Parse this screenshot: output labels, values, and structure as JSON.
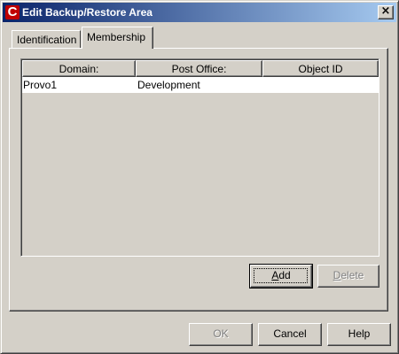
{
  "window": {
    "title": "Edit Backup/Restore Area",
    "icon_glyph": "C",
    "close_label": "×"
  },
  "tabs": [
    {
      "label": "Identification",
      "selected": false
    },
    {
      "label": "Membership",
      "selected": true
    }
  ],
  "membership_table": {
    "columns": [
      "Domain:",
      "Post Office:",
      "Object ID"
    ],
    "rows": [
      {
        "domain": "Provo1",
        "post_office": "Development",
        "object_id": ""
      }
    ]
  },
  "panel_buttons": {
    "add": {
      "label_mnemonic": "A",
      "label_rest": "dd",
      "enabled": true
    },
    "delete": {
      "label_mnemonic": "D",
      "label_rest": "elete",
      "enabled": false
    }
  },
  "dialog_buttons": {
    "ok": {
      "label": "OK",
      "enabled": false
    },
    "cancel": {
      "label": "Cancel",
      "enabled": true
    },
    "help": {
      "label": "Help",
      "enabled": true
    }
  },
  "colors": {
    "face": "#d4d0c8",
    "title_start": "#0a246a",
    "title_end": "#a6caf0",
    "icon_red": "#c00000"
  }
}
